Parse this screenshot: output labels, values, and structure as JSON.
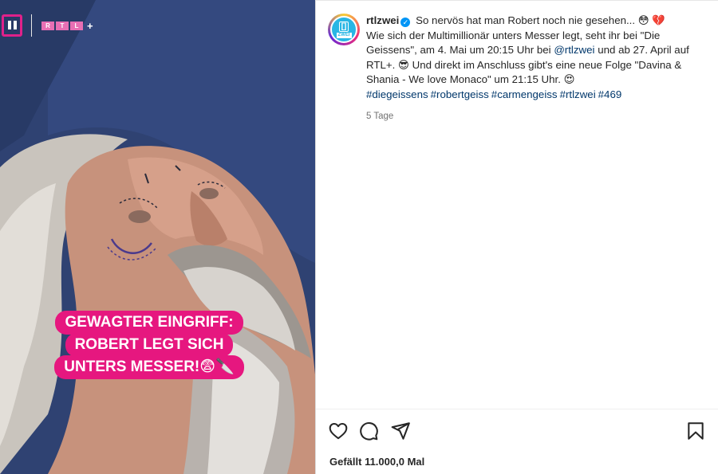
{
  "media": {
    "channel_logo": "rtlzwei-logo-icon",
    "rtl_letters": [
      "R",
      "T",
      "L"
    ],
    "rtl_plus_sign": "+",
    "overlay_lines": [
      "GEWAGTER EINGRIFF:",
      "ROBERT LEGT SICH",
      "UNTERS MESSER!😨🔪"
    ]
  },
  "post": {
    "username": "rtlzwei",
    "verified_icon": "verified-badge-icon",
    "caption_line1": "So nervös hat man Robert noch nie gesehen... 😳 💔",
    "caption_line2a": "Wie sich der Multimillionär unters Messer legt, seht ihr bei \"Die Geissens\", am 4. Mai um 20:15 Uhr bei ",
    "mention": "@rtlzwei",
    "caption_line2b": " und ab 27. April auf RTL+. 😎 Und direkt im Anschluss gibt's eine neue Folge \"Davina & Shania - We love Monaco\" um 21:15 Uhr. 😍",
    "hashtags": [
      "#diegeissens",
      "#robertgeiss",
      "#carmengeiss",
      "#rtlzwei",
      "#469"
    ],
    "time": "5 Tage",
    "likes": "Gefällt 11.000,0 Mal"
  },
  "actions": {
    "like_icon": "heart-icon",
    "comment_icon": "comment-icon",
    "share_icon": "share-icon",
    "save_icon": "bookmark-icon"
  },
  "colors": {
    "overlay_pink": "#e6177f",
    "link_blue": "#00376b",
    "verified_blue": "#0095f6",
    "muted_gray": "#737373"
  }
}
